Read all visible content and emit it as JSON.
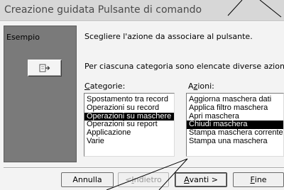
{
  "window": {
    "title": "Creazione guidata Pulsante di comando"
  },
  "example": {
    "label": "Esempio",
    "preview_icon": "open-form-icon"
  },
  "instructions": {
    "line1": "Scegliere l'azione da associare al pulsante.",
    "line2": "Per ciascuna categoria sono elencate diverse azioni."
  },
  "categories": {
    "label_prefix": "",
    "label_access": "C",
    "label_rest": "ategorie:",
    "items": [
      "Spostamento tra record",
      "Operazioni su record",
      "Operazioni su maschere",
      "Operazioni su report",
      "Applicazione",
      "Varie"
    ],
    "selected": "Operazioni su maschere"
  },
  "actions": {
    "label_prefix": "A",
    "label_access": "z",
    "label_rest": "ioni:",
    "items": [
      "Aggiorna maschera dati",
      "Applica filtro maschera",
      "Apri maschera",
      "Chiudi maschera",
      "Stampa maschera corrente",
      "Stampa una maschera"
    ],
    "selected": "Chiudi maschera"
  },
  "buttons": {
    "cancel": "Annulla",
    "back_prefix": "< ",
    "back_access": "I",
    "back_rest": "ndietro",
    "next_access": "A",
    "next_rest": "vanti >",
    "finish_access": "F",
    "finish_rest": "ine"
  },
  "colors": {
    "selection_bg": "#000000",
    "selection_fg": "#ffffff",
    "title_text": "#4a4a4a"
  }
}
